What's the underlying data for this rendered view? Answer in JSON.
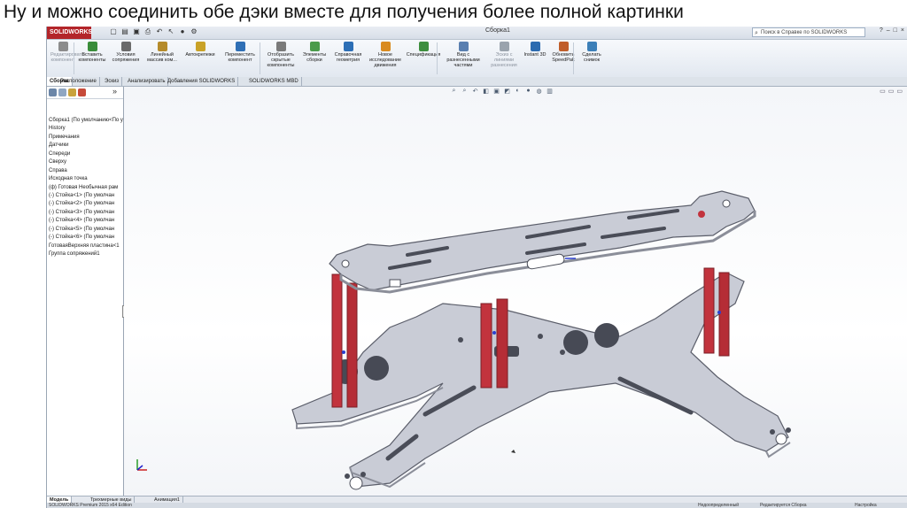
{
  "slide": {
    "title": "Ну и можно соединить обе дэки вместе для получения более полной картинки"
  },
  "app": {
    "logo_text": "SOLIDWORKS",
    "document_title": "Сборка1",
    "help_search_placeholder": "Поиск в Справке по SOLIDWORKS",
    "help_search_icon": "help-search-icon",
    "colors": {
      "brand": "#b3252a",
      "part": "#c9ccd6",
      "standoff": "#c2333d",
      "accent": "#2a6fb8"
    }
  },
  "command_manager": {
    "buttons": [
      {
        "label": "Редактировать компонент",
        "icon": "edit-component-icon",
        "color": "#8c8c8c",
        "enabled": false
      },
      {
        "label": "Вставить компоненты",
        "icon": "insert-components-icon",
        "color": "#3a8d3a",
        "enabled": true
      },
      {
        "label": "Условия сопряжения",
        "icon": "mate-icon",
        "color": "#6b6b6b",
        "enabled": true
      },
      {
        "label": "Линейный массив ком...",
        "icon": "linear-pattern-icon",
        "color": "#b58b2a",
        "enabled": true
      },
      {
        "label": "Автокрепежи",
        "icon": "smart-fasteners-icon",
        "color": "#c9a227",
        "enabled": true
      },
      {
        "label": "Переместить компонент",
        "icon": "move-component-icon",
        "color": "#2f6fb5",
        "enabled": true
      },
      {
        "label": "Отобразить скрытые компоненты",
        "icon": "show-hidden-icon",
        "color": "#7a7a7a",
        "enabled": true
      },
      {
        "label": "Элементы сборки",
        "icon": "assembly-features-icon",
        "color": "#4a9b4a",
        "enabled": true
      },
      {
        "label": "Справочная геометрия",
        "icon": "reference-geometry-icon",
        "color": "#2d6fb6",
        "enabled": true
      },
      {
        "label": "Новое исследование движения",
        "icon": "motion-study-icon",
        "color": "#d98b1f",
        "enabled": true
      },
      {
        "label": "Спецификация",
        "icon": "bom-icon",
        "color": "#3e8e3e",
        "enabled": true
      },
      {
        "label": "Вид с разнесенными частями",
        "icon": "exploded-view-icon",
        "color": "#5a7fb0",
        "enabled": true
      },
      {
        "label": "Эскиз с линиями разнесения",
        "icon": "explode-line-sketch-icon",
        "color": "#9aa3ad",
        "enabled": false
      },
      {
        "label": "Instant 3D",
        "icon": "instant3d-icon",
        "color": "#2c6bb0",
        "enabled": true
      },
      {
        "label": "Обновить SpeedPak",
        "icon": "speedpak-icon",
        "color": "#c05e2a",
        "enabled": true
      },
      {
        "label": "Сделать снимок",
        "icon": "snapshot-icon",
        "color": "#3c7fb8",
        "enabled": true
      }
    ]
  },
  "tabs": [
    {
      "label": "Сборка",
      "active": true
    },
    {
      "label": "Расположение",
      "active": false
    },
    {
      "label": "Эскиз",
      "active": false
    },
    {
      "label": "Анализировать",
      "active": false
    },
    {
      "label": "Добавления SOLIDWORKS",
      "active": false
    },
    {
      "label": "SOLIDWORKS MBD",
      "active": false
    }
  ],
  "tree": {
    "items": [
      "Сборка1  (По умолчанию<По у",
      "History",
      "Примечания",
      "Датчики",
      "Спереди",
      "Сверху",
      "Справа",
      "Исходная точка",
      "(ф) Готовая Необычная рам",
      "(-) Стойка<1> (По умолчан",
      "(-) Стойка<2> (По умолчан",
      "(-) Стойка<3> (По умолчан",
      "(-) Стойка<4> (По умолчан",
      "(-) Стойка<5> (По умолчан",
      "(-) Стойка<6> (По умолчан",
      "ГотоваяВерхняя пластина<1",
      "Группа сопряжений1"
    ],
    "expand_icon": "double-chevron-icon"
  },
  "bottom_tabs": [
    {
      "label": "Модель",
      "active": true
    },
    {
      "label": "Трехмерные виды",
      "active": false
    },
    {
      "label": "Анимация1",
      "active": false
    }
  ],
  "status": {
    "left": "SOLIDWORKS Premium 2015 x64 Edition",
    "middle": "Недоопределенный",
    "right": "Редактируется Сборка",
    "custom": "Настройка"
  }
}
